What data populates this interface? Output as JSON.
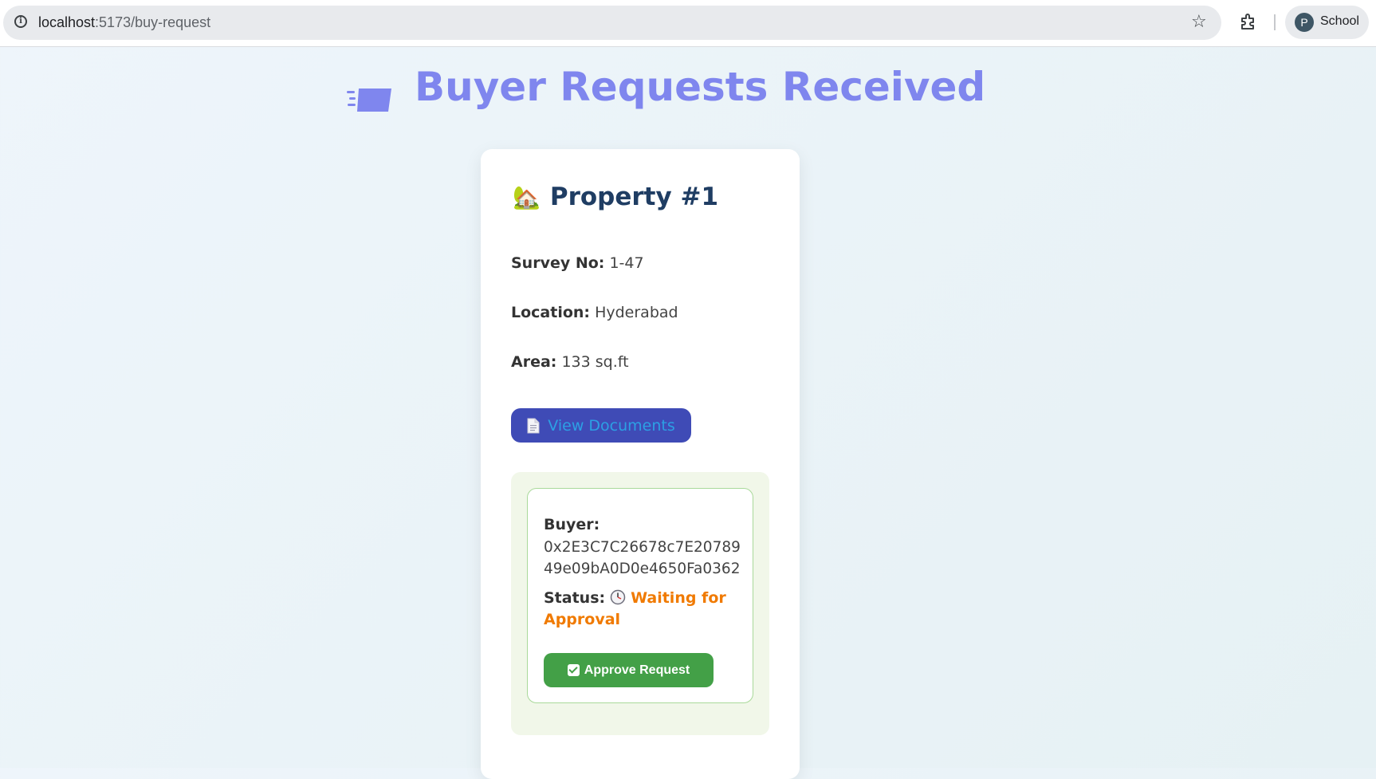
{
  "browser": {
    "url_host": "localhost",
    "url_path": ":5173/buy-request",
    "profile_initial": "P",
    "profile_name": "School"
  },
  "page": {
    "title": "Buyer Requests Received",
    "heading_icon": "flying-card-icon",
    "title_color": "#7f86ee"
  },
  "property": {
    "title": "Property #1",
    "title_icon": "house-icon",
    "survey_label": "Survey No:",
    "survey_value": "1-47",
    "location_label": "Location:",
    "location_value": "Hyderabad",
    "area_label": "Area:",
    "area_value": "133 sq.ft",
    "view_documents_label": "View Documents"
  },
  "request": {
    "buyer_label": "Buyer:",
    "buyer_address": "0x2E3C7C26678c7E2078949e09bA0D0e4650Fa0362",
    "status_label": "Status:",
    "status_icon": "clock-icon",
    "status_value": "Waiting for Approval",
    "status_color": "#f07a00",
    "approve_label": "Approve Request",
    "approve_color": "#43a047"
  }
}
